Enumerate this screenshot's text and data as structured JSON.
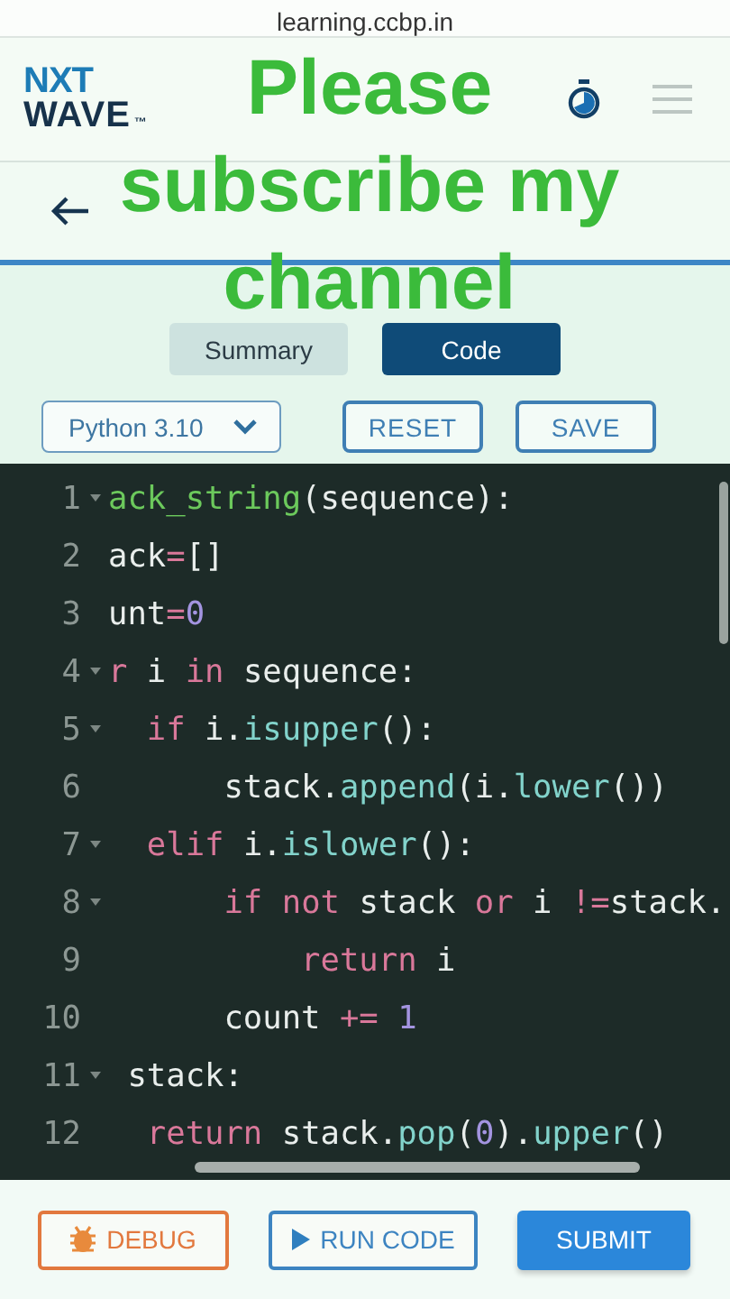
{
  "address_bar": {
    "url": "learning.ccbp.in"
  },
  "header": {
    "logo_top": "NXT",
    "logo_bottom": "WAVE",
    "logo_mark": "™"
  },
  "overlay_caption": [
    "Please",
    "subscribe my",
    "channel"
  ],
  "tabs": [
    {
      "label": "Summary",
      "selected": false
    },
    {
      "label": "Code",
      "selected": true
    }
  ],
  "language_select": {
    "value": "Python 3.10"
  },
  "actions": [
    "RESET",
    "SAVE"
  ],
  "code_lines": [
    {
      "number": "1",
      "foldable": true,
      "tokens": [
        {
          "text": "ack_string",
          "kind": "def"
        },
        {
          "text": "(sequence):",
          "kind": "plain"
        }
      ]
    },
    {
      "number": "2",
      "foldable": false,
      "tokens": [
        {
          "text": "ack",
          "kind": "plain"
        },
        {
          "text": "=",
          "kind": "op"
        },
        {
          "text": "[]",
          "kind": "plain"
        }
      ]
    },
    {
      "number": "3",
      "foldable": false,
      "tokens": [
        {
          "text": "unt",
          "kind": "plain"
        },
        {
          "text": "=",
          "kind": "op"
        },
        {
          "text": "0",
          "kind": "num"
        }
      ]
    },
    {
      "number": "4",
      "foldable": true,
      "tokens": [
        {
          "text": "r",
          "kind": "kw"
        },
        {
          "text": " i ",
          "kind": "plain"
        },
        {
          "text": "in",
          "kind": "kw"
        },
        {
          "text": " sequence:",
          "kind": "plain"
        }
      ]
    },
    {
      "number": "5",
      "foldable": true,
      "tokens": [
        {
          "text": "  if",
          "kind": "kw"
        },
        {
          "text": " i.",
          "kind": "plain"
        },
        {
          "text": "isupper",
          "kind": "fn"
        },
        {
          "text": "():",
          "kind": "plain"
        }
      ]
    },
    {
      "number": "6",
      "foldable": false,
      "tokens": [
        {
          "text": "      stack.",
          "kind": "plain"
        },
        {
          "text": "append",
          "kind": "fn"
        },
        {
          "text": "(i.",
          "kind": "plain"
        },
        {
          "text": "lower",
          "kind": "fn"
        },
        {
          "text": "())",
          "kind": "plain"
        }
      ]
    },
    {
      "number": "7",
      "foldable": true,
      "tokens": [
        {
          "text": "  elif",
          "kind": "kw"
        },
        {
          "text": " i.",
          "kind": "plain"
        },
        {
          "text": "islower",
          "kind": "fn"
        },
        {
          "text": "():",
          "kind": "plain"
        }
      ]
    },
    {
      "number": "8",
      "foldable": true,
      "tokens": [
        {
          "text": "      if",
          "kind": "kw"
        },
        {
          "text": " not",
          "kind": "kw"
        },
        {
          "text": " stack ",
          "kind": "plain"
        },
        {
          "text": "or",
          "kind": "kw"
        },
        {
          "text": " i ",
          "kind": "plain"
        },
        {
          "text": "!=",
          "kind": "op"
        },
        {
          "text": "stack.",
          "kind": "plain"
        }
      ]
    },
    {
      "number": "9",
      "foldable": false,
      "tokens": [
        {
          "text": "          return",
          "kind": "kw"
        },
        {
          "text": " i",
          "kind": "plain"
        }
      ]
    },
    {
      "number": "10",
      "foldable": false,
      "tokens": [
        {
          "text": "      count ",
          "kind": "plain"
        },
        {
          "text": "+=",
          "kind": "op"
        },
        {
          "text": " 1",
          "kind": "num"
        }
      ]
    },
    {
      "number": "11",
      "foldable": true,
      "tokens": [
        {
          "text": " stack:",
          "kind": "plain"
        }
      ]
    },
    {
      "number": "12",
      "foldable": false,
      "tokens": [
        {
          "text": "  return",
          "kind": "kw"
        },
        {
          "text": " stack.",
          "kind": "plain"
        },
        {
          "text": "pop",
          "kind": "fn"
        },
        {
          "text": "(",
          "kind": "plain"
        },
        {
          "text": "0",
          "kind": "num"
        },
        {
          "text": ").",
          "kind": "plain"
        },
        {
          "text": "upper",
          "kind": "fn"
        },
        {
          "text": "()",
          "kind": "plain"
        }
      ]
    }
  ],
  "footer_buttons": [
    {
      "label": "DEBUG",
      "kind": "debug"
    },
    {
      "label": "RUN CODE",
      "kind": "run"
    },
    {
      "label": "SUBMIT",
      "kind": "submit"
    }
  ]
}
